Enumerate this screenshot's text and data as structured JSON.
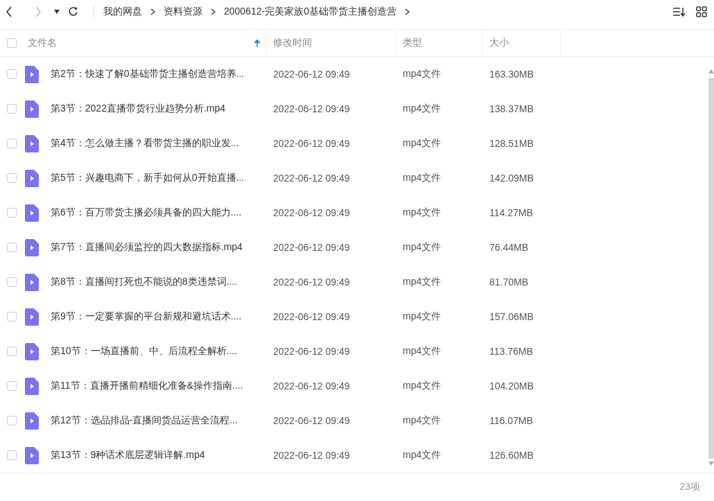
{
  "toolbar": {
    "breadcrumbs": [
      "我的网盘",
      "资料资源",
      "2000612-完美家族0基础带货主播创造营"
    ]
  },
  "table": {
    "header_checked": false,
    "columns": [
      "文件名",
      "修改时间",
      "类型",
      "大小"
    ],
    "rows": [
      {
        "checked": false,
        "name": "第2节：快速了解0基础带货主播创造营培养...",
        "modified": "2022-06-12 09:49",
        "type": "mp4文件",
        "size": "163.30MB"
      },
      {
        "checked": false,
        "name": "第3节：2022直播带货行业趋势分析.mp4",
        "modified": "2022-06-12 09:49",
        "type": "mp4文件",
        "size": "138.37MB"
      },
      {
        "checked": false,
        "name": "第4节：怎么做主播？看带货主播的职业发...",
        "modified": "2022-06-12 09:49",
        "type": "mp4文件",
        "size": "128.51MB"
      },
      {
        "checked": false,
        "name": "第5节：兴趣电商下，新手如何从0开始直播...",
        "modified": "2022-06-12 09:49",
        "type": "mp4文件",
        "size": "142.09MB"
      },
      {
        "checked": false,
        "name": "第6节：百万带货主播必须具备的四大能力....",
        "modified": "2022-06-12 09:49",
        "type": "mp4文件",
        "size": "114.27MB"
      },
      {
        "checked": false,
        "name": "第7节：直播间必须监控的四大数据指标.mp4",
        "modified": "2022-06-12 09:49",
        "type": "mp4文件",
        "size": "76.44MB"
      },
      {
        "checked": false,
        "name": "第8节：直播间打死也不能说的8类违禁词....",
        "modified": "2022-06-12 09:49",
        "type": "mp4文件",
        "size": "81.70MB"
      },
      {
        "checked": false,
        "name": "第9节：一定要掌握的平台新规和避坑话术....",
        "modified": "2022-06-12 09:49",
        "type": "mp4文件",
        "size": "157.06MB"
      },
      {
        "checked": false,
        "name": "第10节：一场直播前、中、后流程全解析....",
        "modified": "2022-06-12 09:49",
        "type": "mp4文件",
        "size": "113.76MB"
      },
      {
        "checked": false,
        "name": "第11节：直播开播前精细化准备&操作指南....",
        "modified": "2022-06-12 09:49",
        "type": "mp4文件",
        "size": "104.20MB"
      },
      {
        "checked": false,
        "name": "第12节：选品排品-直播间货品运营全流程...",
        "modified": "2022-06-12 09:49",
        "type": "mp4文件",
        "size": "116.07MB"
      },
      {
        "checked": false,
        "name": "第13节：9种话术底层逻辑详解.mp4",
        "modified": "2022-06-12 09:49",
        "type": "mp4文件",
        "size": "126.60MB"
      }
    ]
  },
  "status_bar": {
    "count": "23项"
  }
}
